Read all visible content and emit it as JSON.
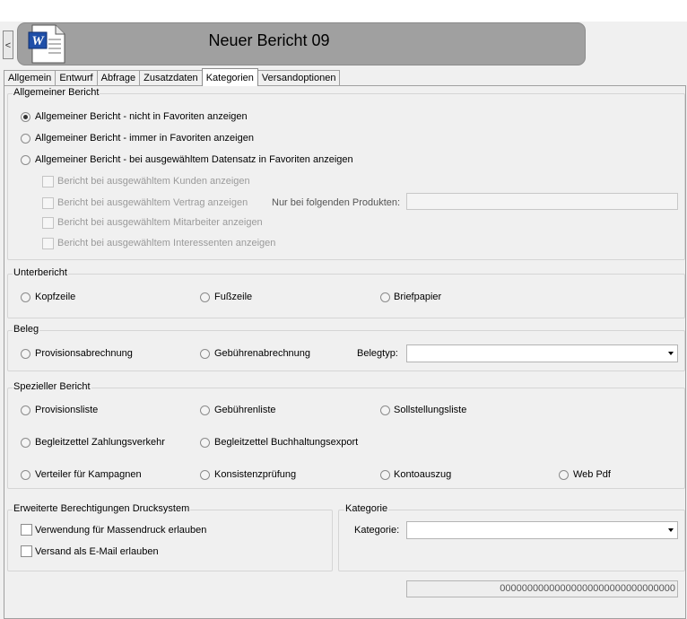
{
  "header": {
    "back_label": "<",
    "title": "Neuer Bericht 09",
    "doc_icon_letter": "W"
  },
  "tabs": [
    {
      "label": "Allgemein",
      "active": false
    },
    {
      "label": "Entwurf",
      "active": false
    },
    {
      "label": "Abfrage",
      "active": false
    },
    {
      "label": "Zusatzdaten",
      "active": false
    },
    {
      "label": "Kategorien",
      "active": true
    },
    {
      "label": "Versandoptionen",
      "active": false
    }
  ],
  "allgemein": {
    "title": "Allgemeiner Bericht",
    "options": [
      {
        "label": "Allgemeiner Bericht - nicht in Favoriten anzeigen",
        "checked": true
      },
      {
        "label": "Allgemeiner Bericht - immer in Favoriten anzeigen",
        "checked": false
      },
      {
        "label": "Allgemeiner Bericht - bei ausgewähltem Datensatz in Favoriten anzeigen",
        "checked": false
      }
    ],
    "sub_checks": [
      {
        "label": "Bericht bei ausgewähltem Kunden anzeigen",
        "checked": false
      },
      {
        "label": "Bericht bei ausgewähltem Vertrag anzeigen",
        "checked": false
      },
      {
        "label": "Bericht bei ausgewähltem Mitarbeiter anzeigen",
        "checked": false
      },
      {
        "label": "Bericht bei ausgewähltem Interessenten anzeigen",
        "checked": false
      }
    ],
    "products_label": "Nur bei folgenden Produkten:",
    "products_value": ""
  },
  "unterbericht": {
    "title": "Unterbericht",
    "options": [
      "Kopfzeile",
      "Fußzeile",
      "Briefpapier"
    ]
  },
  "beleg": {
    "title": "Beleg",
    "options": [
      "Provisionsabrechnung",
      "Gebührenabrechnung"
    ],
    "belegtyp_label": "Belegtyp:",
    "belegtyp_value": ""
  },
  "spezieller": {
    "title": "Spezieller Bericht",
    "options": [
      "Provisionsliste",
      "Gebührenliste",
      "Sollstellungsliste",
      "Begleitzettel Zahlungsverkehr",
      "Begleitzettel Buchhaltungsexport",
      "Verteiler für Kampagnen",
      "Konsistenzprüfung",
      "Kontoauszug",
      "Web Pdf"
    ]
  },
  "drucksystem": {
    "title": "Erweiterte Berechtigungen Drucksystem",
    "checks": [
      {
        "label": "Verwendung für Massendruck erlauben",
        "checked": false
      },
      {
        "label": "Versand als E-Mail erlauben",
        "checked": false
      }
    ]
  },
  "kategorie": {
    "title": "Kategorie",
    "label": "Kategorie:",
    "value": ""
  },
  "footer": {
    "id_value": "00000000000000000000000000000000"
  }
}
